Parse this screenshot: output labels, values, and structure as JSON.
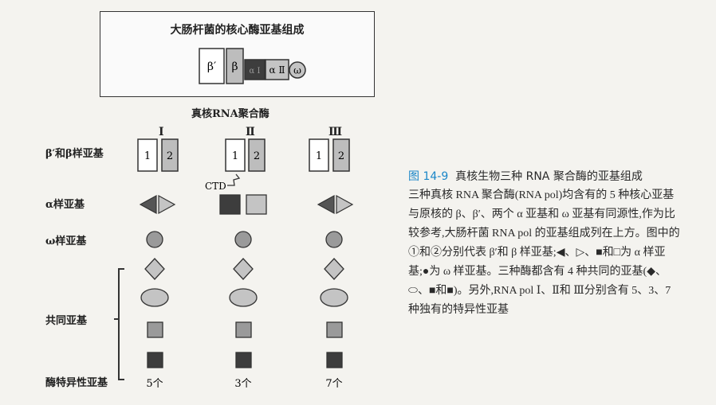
{
  "top_box": {
    "title": "大肠杆菌的核心酶亚基组成",
    "subunits": [
      "β′",
      "β",
      "α Ⅰ",
      "α Ⅱ",
      "ω"
    ]
  },
  "section_title": "真核RNA聚合酶",
  "polymerases": [
    "Ⅰ",
    "Ⅱ",
    "Ⅲ"
  ],
  "row_labels": {
    "beta": "β′和β样亚基",
    "alpha": "α样亚基",
    "omega": "ω样亚基",
    "common": "共同亚基",
    "specific": "酶特异性亚基"
  },
  "beta_numbers": [
    "1",
    "2"
  ],
  "ctd_label": "CTD",
  "specific_counts": [
    "5个",
    "3个",
    "7个"
  ],
  "caption": {
    "fig_label": "图 14-9",
    "title": "真核生物三种 RNA 聚合酶的亚基组成",
    "body": "三种真核 RNA 聚合酶(RNA pol)均含有的 5 种核心亚基与原核的 β、β′、两个 α 亚基和 ω 亚基有同源性,作为比较参考,大肠杆菌 RNA pol 的亚基组成列在上方。图中的①和②分别代表 β′和 β 样亚基;◀、▷、■和□为 α 样亚基;●为 ω 样亚基。三种酶都含有 4 种共同的亚基(◆、⬭、■和■)。另外,RNA pol Ⅰ、Ⅱ和 Ⅲ分别含有 5、3、7 种独有的特异性亚基"
  },
  "colors": {
    "dark": "#3d3d3d",
    "mid": "#8f8f8f",
    "light": "#c4c4c4",
    "accent": "#1a86c8"
  }
}
